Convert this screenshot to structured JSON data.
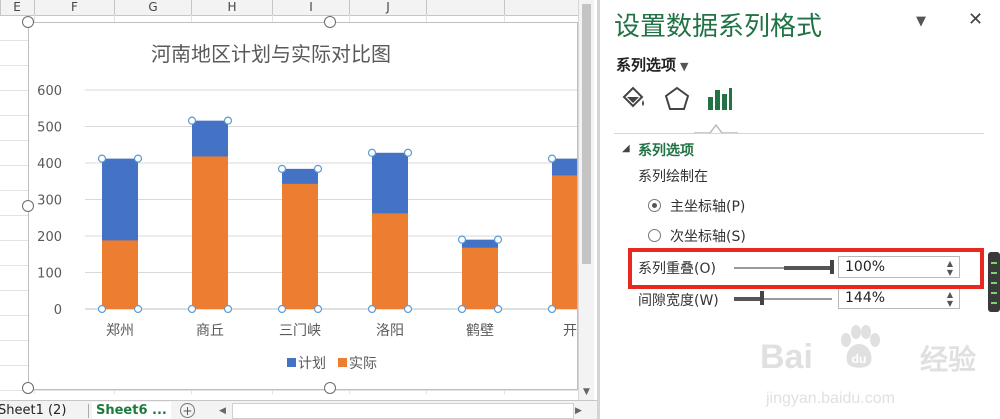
{
  "sheet": {
    "columns": [
      "E",
      "F",
      "G",
      "H",
      "I",
      "J"
    ],
    "tabs": [
      "Sheet1 (2)",
      "Sheet6 ..."
    ],
    "add_sheet_symbol": "+"
  },
  "chart_data": {
    "type": "bar",
    "title": "河南地区计划与实际对比图",
    "categories": [
      "郑州",
      "商丘",
      "三门峡",
      "洛阳",
      "鹤壁",
      "开"
    ],
    "series": [
      {
        "name": "计划",
        "color": "#4472c4",
        "values": [
          412,
          516,
          384,
          428,
          190,
          412
        ]
      },
      {
        "name": "实际",
        "color": "#ed7d31",
        "values": [
          188,
          418,
          343,
          262,
          168,
          366
        ]
      }
    ],
    "overlap_percent": 100,
    "ylim": [
      0,
      600
    ],
    "yticks": [
      "0",
      "100",
      "200",
      "300",
      "400",
      "500",
      "600"
    ],
    "grid": true,
    "legend_position": "bottom"
  },
  "panel": {
    "title": "设置数据系列格式",
    "dropdown_symbol": "▼",
    "close_symbol": "✕",
    "tab_name": "系列选项",
    "icons": [
      "paint-bucket-icon",
      "pentagon-icon",
      "bar-chart-icon"
    ],
    "section_title": "系列选项",
    "plot_on_label": "系列绘制在",
    "primary_axis": "主坐标轴(P)",
    "secondary_axis": "次坐标轴(S)",
    "primary_selected": true,
    "overlap_label": "系列重叠(O)",
    "overlap_value": "100%",
    "overlap_level": 1.0,
    "gap_label": "间隙宽度(W)",
    "gap_value": "144%",
    "gap_level": 0.29
  },
  "watermark": {
    "brand": "Bai",
    "brand_cn": "经验",
    "url": "jingyan.baidu.com"
  }
}
